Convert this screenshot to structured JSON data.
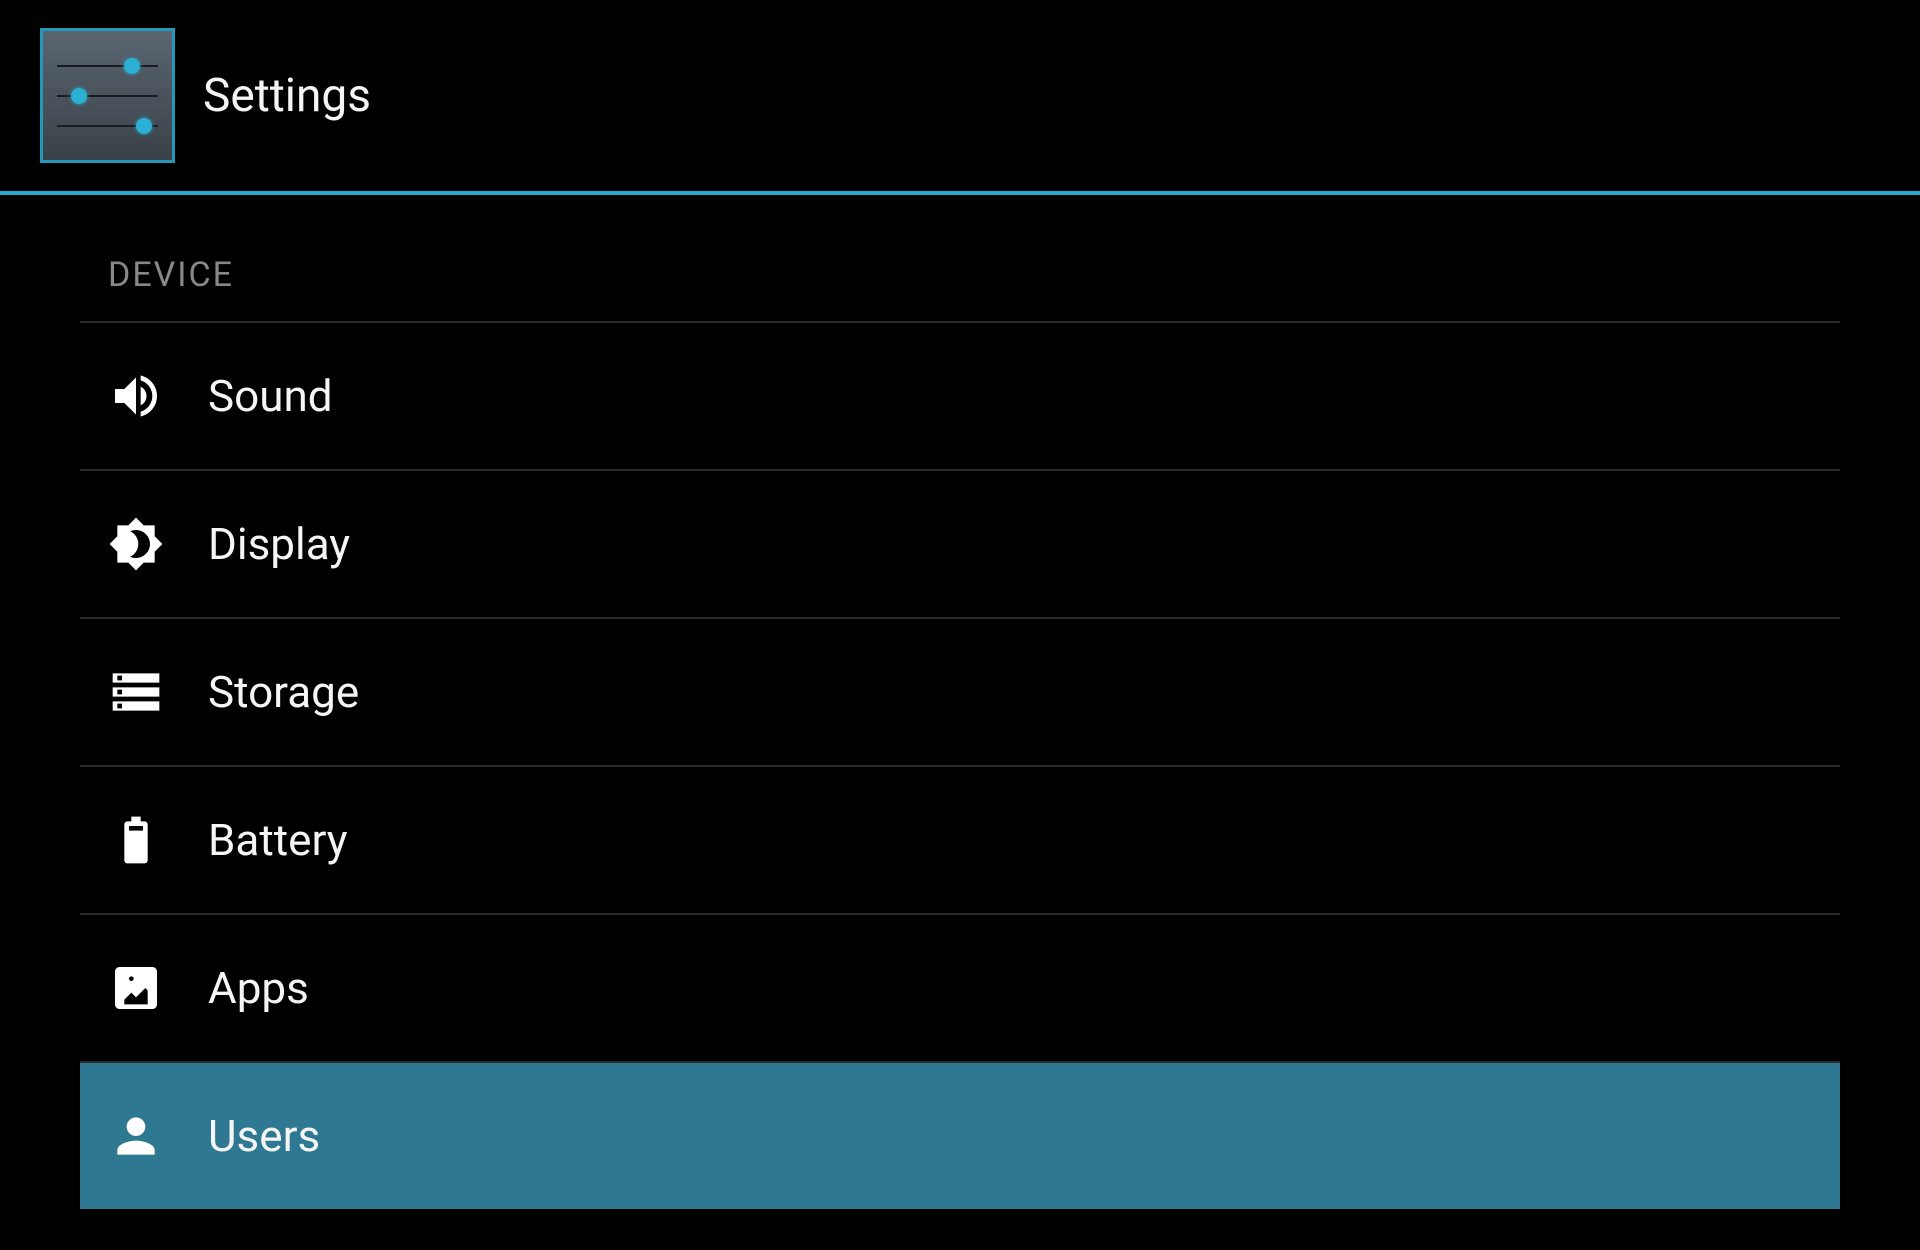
{
  "header": {
    "title": "Settings"
  },
  "section": {
    "title": "DEVICE"
  },
  "items": [
    {
      "icon": "sound-icon",
      "label": "Sound",
      "selected": false
    },
    {
      "icon": "display-icon",
      "label": "Display",
      "selected": false
    },
    {
      "icon": "storage-icon",
      "label": "Storage",
      "selected": false
    },
    {
      "icon": "battery-icon",
      "label": "Battery",
      "selected": false
    },
    {
      "icon": "apps-icon",
      "label": "Apps",
      "selected": false
    },
    {
      "icon": "users-icon",
      "label": "Users",
      "selected": true
    }
  ],
  "colors": {
    "accent": "#29a8cc",
    "selected": "#2f7891",
    "background": "#000000",
    "text": "#f5f5f5",
    "textMuted": "#888888",
    "divider": "#2a2a2a"
  }
}
